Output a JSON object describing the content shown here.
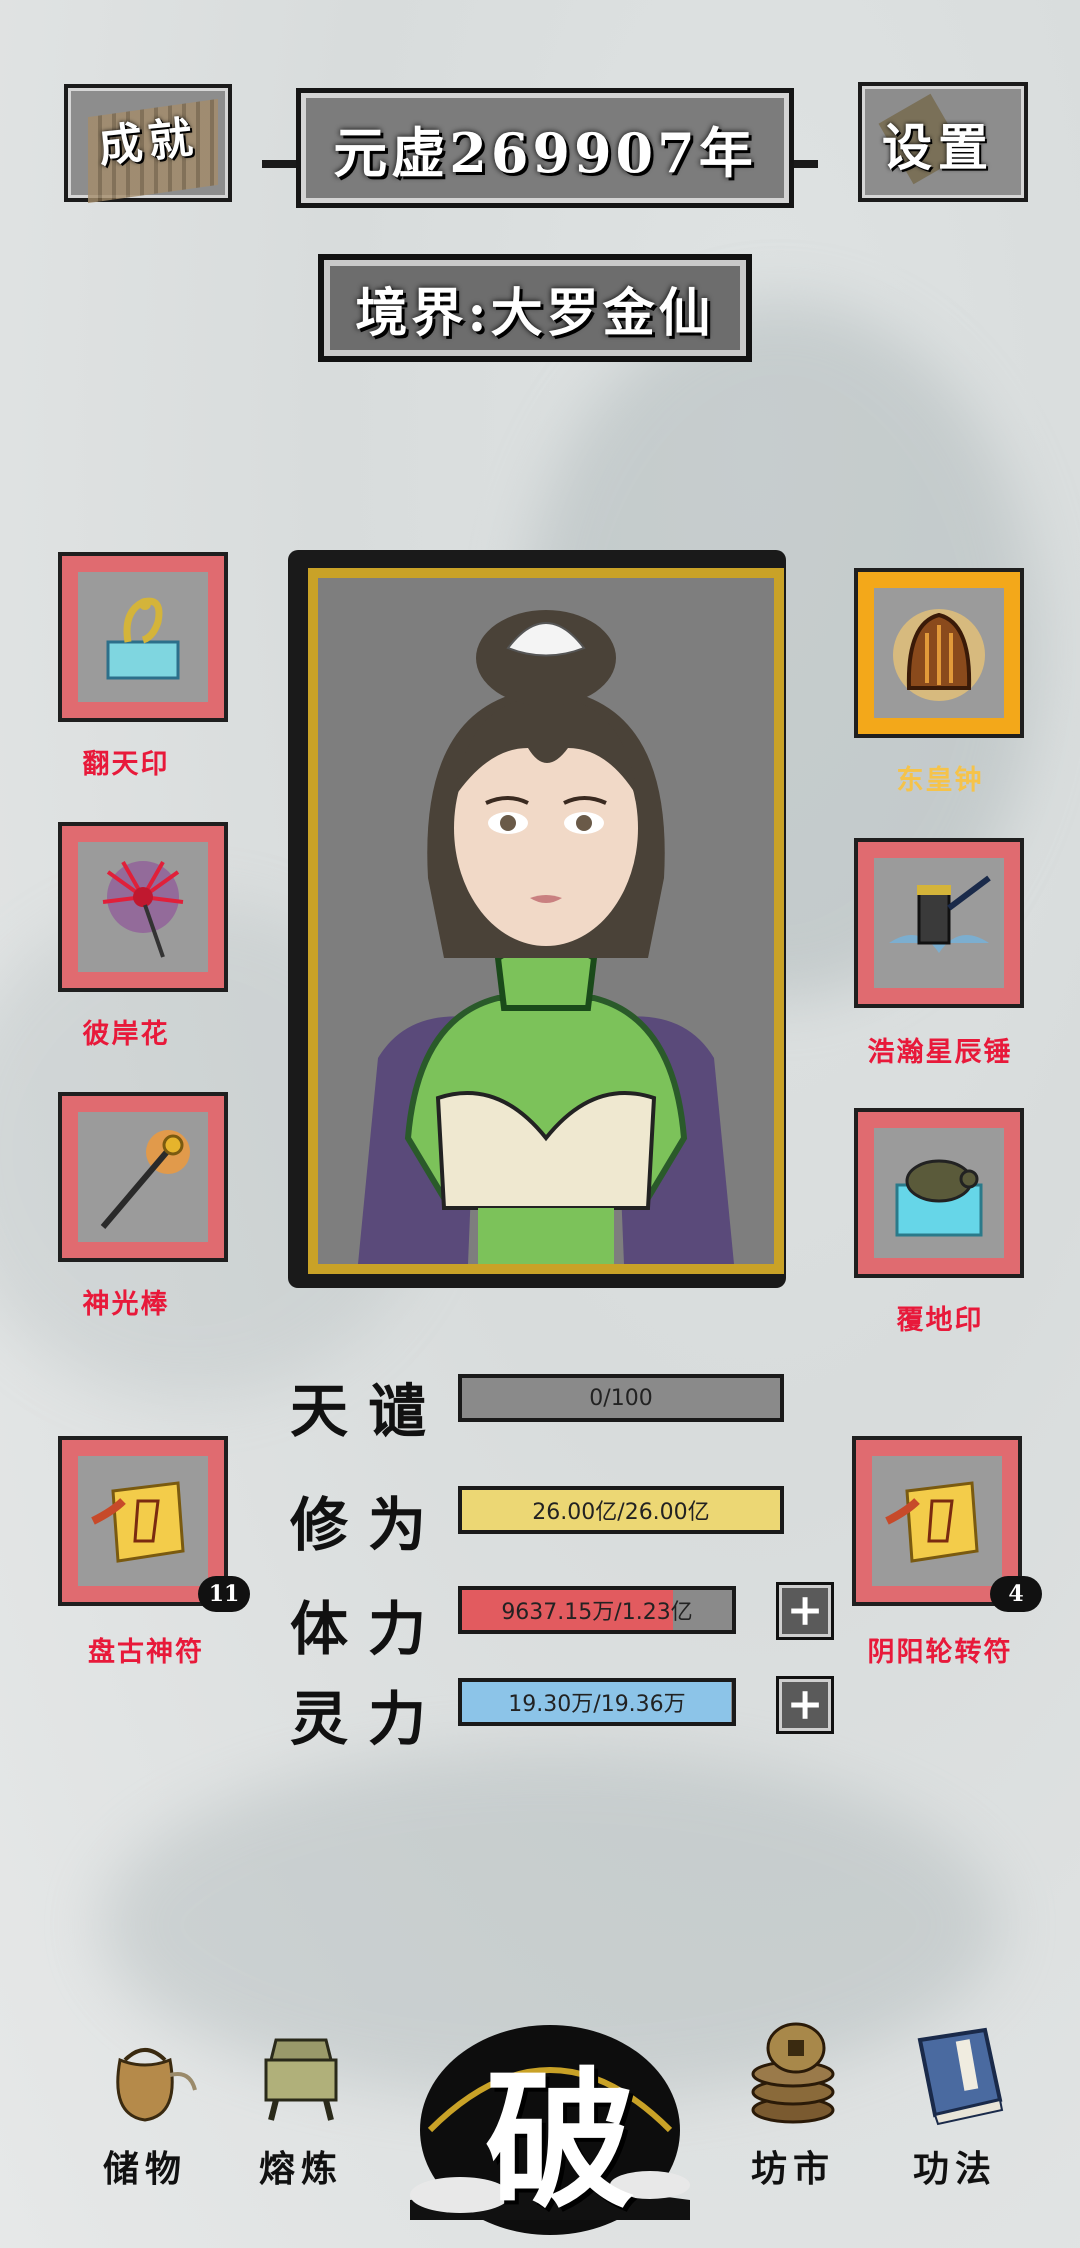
{
  "header": {
    "achievements_label": "成就",
    "era_title": "元虚269907年",
    "settings_label": "设置",
    "realm_title": "境界:大罗金仙"
  },
  "equipment": {
    "left": [
      {
        "name": "翻天印",
        "icon": "seal-dragon-icon"
      },
      {
        "name": "彼岸花",
        "icon": "spider-lily-icon"
      },
      {
        "name": "神光棒",
        "icon": "staff-icon"
      }
    ],
    "right": [
      {
        "name": "东皇钟",
        "icon": "bell-icon"
      },
      {
        "name": "浩瀚星辰锤",
        "icon": "hammer-icon"
      },
      {
        "name": "覆地印",
        "icon": "seal-turtle-icon"
      }
    ]
  },
  "talismans": {
    "left": {
      "name": "盘古神符",
      "count": "11"
    },
    "right": {
      "name": "阴阳轮转符",
      "count": "4"
    }
  },
  "stats": {
    "tribulation": {
      "label": "天谴",
      "text": "0/100",
      "fill": 0,
      "color": "#8a8a8a"
    },
    "cultivation": {
      "label": "修为",
      "text": "26.00亿/26.00亿",
      "fill": 1.0,
      "color": "#ecd774"
    },
    "stamina": {
      "label": "体力",
      "text": "9637.15万/1.23亿",
      "fill": 0.78,
      "color": "#e25b5f"
    },
    "spirit": {
      "label": "灵力",
      "text": "19.30万/19.36万",
      "fill": 0.997,
      "color": "#8cc4e8"
    }
  },
  "nav": {
    "storage": "储物",
    "smelting": "熔炼",
    "breakthrough": "破",
    "market": "坊市",
    "techniques": "功法"
  },
  "colors": {
    "slot_red": "#e06b70",
    "slot_gold": "#f3a81a",
    "label_red": "#e8193a",
    "label_gold": "#f5c34a"
  }
}
